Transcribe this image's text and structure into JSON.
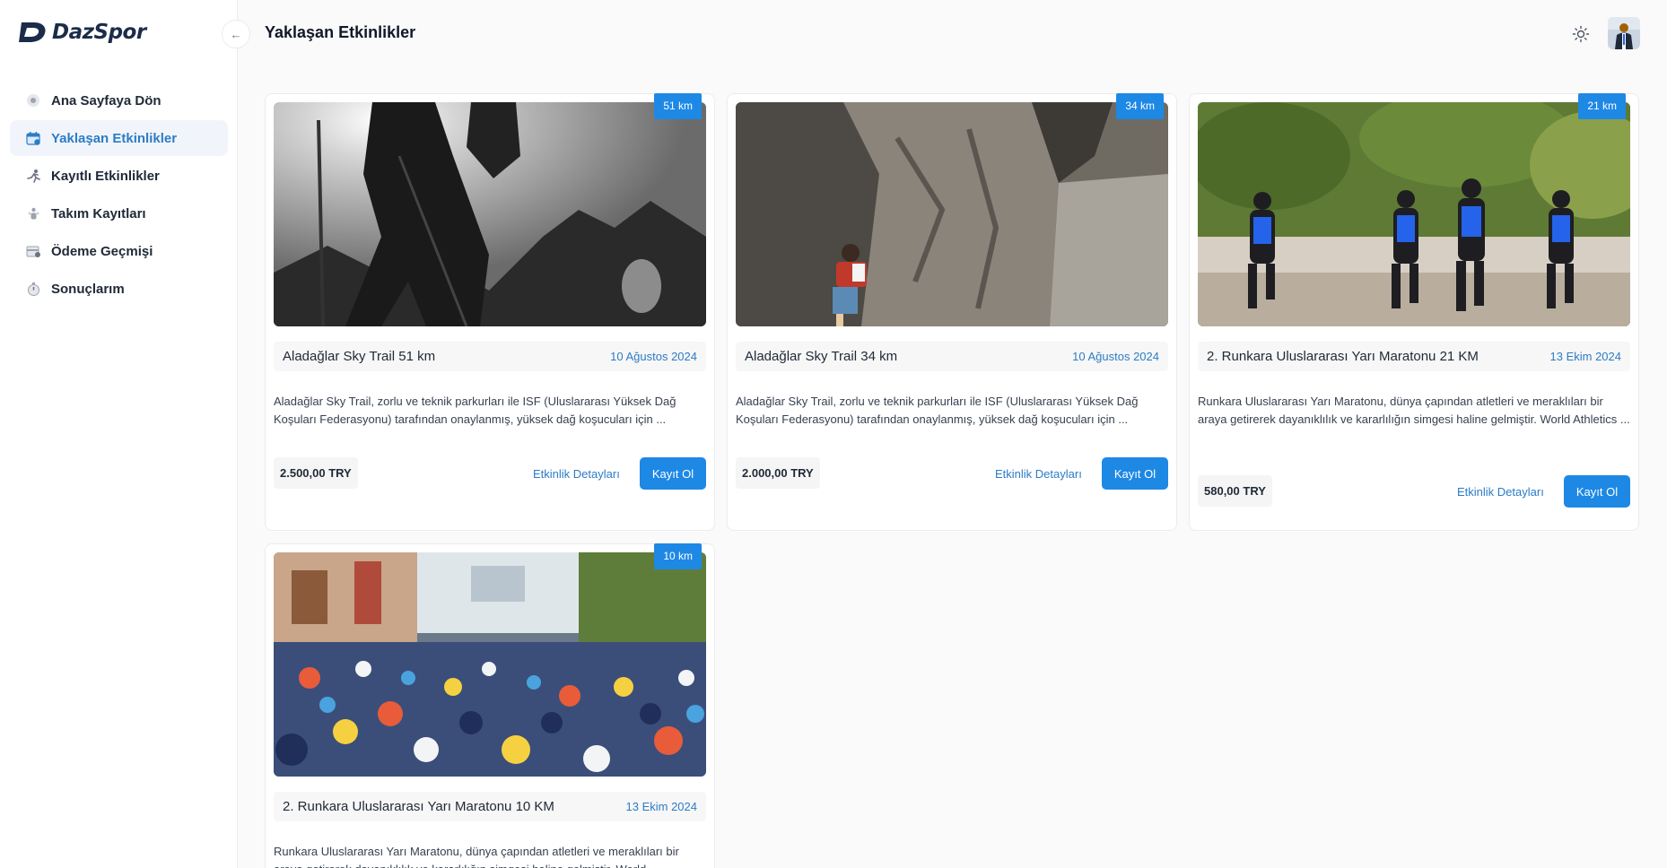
{
  "app": {
    "logo_text": "DazSpor"
  },
  "header": {
    "title": "Yaklaşan Etkinlikler"
  },
  "sidebar": {
    "items": [
      {
        "label": "Ana Sayfaya Dön",
        "icon": "home-icon",
        "active": false
      },
      {
        "label": "Yaklaşan Etkinlikler",
        "icon": "calendar-icon",
        "active": true
      },
      {
        "label": "Kayıtlı Etkinlikler",
        "icon": "runner-icon",
        "active": false
      },
      {
        "label": "Takım Kayıtları",
        "icon": "team-icon",
        "active": false
      },
      {
        "label": "Ödeme Geçmişi",
        "icon": "payment-icon",
        "active": false
      },
      {
        "label": "Sonuçlarım",
        "icon": "stopwatch-icon",
        "active": false
      }
    ]
  },
  "events": [
    {
      "badge": "51 km",
      "title": "Aladağlar Sky Trail 51 km",
      "date": "10 Ağustos 2024",
      "description": "Aladağlar Sky Trail, zorlu ve teknik parkurları ile ISF (Uluslararası Yüksek Dağ Koşuları Federasyonu) tarafından onaylanmış, yüksek dağ koşucuları için ...",
      "price": "2.500,00 TRY",
      "details_label": "Etkinlik Detayları",
      "register_label": "Kayıt Ol",
      "image": "hiker-silhouette-photo"
    },
    {
      "badge": "34 km",
      "title": "Aladağlar Sky Trail 34 km",
      "date": "10 Ağustos 2024",
      "description": "Aladağlar Sky Trail, zorlu ve teknik parkurları ile ISF (Uluslararası Yüksek Dağ Koşuları Federasyonu) tarafından onaylanmış, yüksek dağ koşucuları için ...",
      "price": "2.000,00 TRY",
      "details_label": "Etkinlik Detayları",
      "register_label": "Kayıt Ol",
      "image": "rock-climber-photo"
    },
    {
      "badge": "21 km",
      "title": "2. Runkara Uluslararası Yarı Maratonu 21 KM",
      "date": "13 Ekim 2024",
      "description": "Runkara Uluslararası Yarı Maratonu, dünya çapından atletleri ve meraklıları bir araya getirerek dayanıklılık ve kararlılığın simgesi haline gelmiştir. World Athletics ...",
      "price": "580,00 TRY",
      "details_label": "Etkinlik Detayları",
      "register_label": "Kayıt Ol",
      "image": "marathon-runners-photo"
    },
    {
      "badge": "10 km",
      "title": "2. Runkara Uluslararası Yarı Maratonu 10 KM",
      "date": "13 Ekim 2024",
      "description": "Runkara Uluslararası Yarı Maratonu, dünya çapından atletleri ve meraklıları bir araya getirerek dayanıklılık ve kararlılığın simgesi haline gelmiştir. World",
      "price": "",
      "details_label": "",
      "register_label": "",
      "image": "crowd-runners-photo"
    }
  ],
  "colors": {
    "accent": "#1e88e5",
    "link": "#2c7cc6",
    "active_bg": "#f1f5fb"
  }
}
